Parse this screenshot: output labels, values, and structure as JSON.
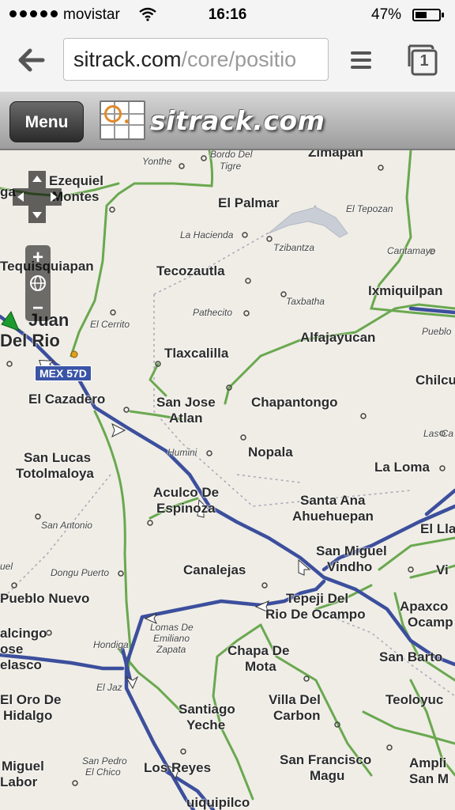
{
  "status_bar": {
    "carrier": "movistar",
    "time": "16:16",
    "battery": "47%",
    "battery_level": 0.47
  },
  "browser": {
    "url_dark": "sitrack.com",
    "url_light": "/core/positio",
    "tab_count": "1"
  },
  "app_header": {
    "menu_label": "Menu",
    "logo_text": "sitrack.com"
  },
  "map": {
    "road_shield": "MEX 57D",
    "zoom_in": "+",
    "zoom_out": "−",
    "labels": [
      "Zimapan",
      "Yonthe",
      "Bordo Del",
      "Tigre",
      "Ezequiel",
      "Montes",
      "ga",
      "El Palmar",
      "El Tepozan",
      "La Hacienda",
      "Tzibantza",
      "Cantamaye",
      "Tequisquiapan",
      "Tecozautla",
      "Taxbatha",
      "Ixmiquilpan",
      "Juan",
      "Del Rio",
      "Pathecito",
      "El Cerrito",
      "Tlaxcalilla",
      "Alfajayucan",
      "Pueblo",
      "Chilcu",
      "El Cazadero",
      "San Jose",
      "Atlan",
      "Chapantongo",
      "Las Ca",
      "Humini",
      "Nopala",
      "San Lucas",
      "Totolmaloya",
      "La Loma",
      "Aculco De",
      "Espinoza",
      "San Antonio",
      "Santa Ana",
      "Ahuehuepan",
      "El Lla",
      "San Miguel",
      "Vindho",
      "uel",
      "Dongu Puerto",
      "Canalejas",
      "Vi",
      "Pueblo Nuevo",
      "Tepeji Del",
      "Rio De Ocampo",
      "Apaxco",
      "Ocamp",
      "alcingo",
      "ose",
      "elasco",
      "Lomas De",
      "Emiliano",
      "Zapata",
      "Hondiga",
      "Chapa De",
      "Mota",
      "San Barto",
      "El Jaz",
      "El Oro De",
      "Hidalgo",
      "Santiago",
      "Yeche",
      "Villa Del",
      "Carbon",
      "Teoloyuc",
      "Miguel",
      "Labor",
      "San Pedro",
      "El Chico",
      "Los Reyes",
      "San Francisco",
      "Magu",
      "Ampli",
      "San M",
      "uiquipilco"
    ]
  }
}
